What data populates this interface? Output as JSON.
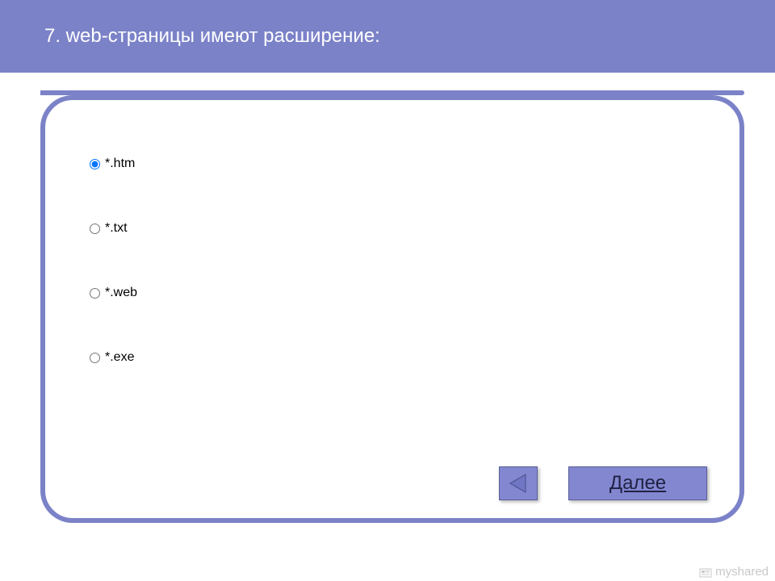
{
  "question": {
    "title": "7. web-страницы имеют расширение:",
    "options": [
      {
        "label": "*.htm",
        "selected": true
      },
      {
        "label": "*.txt",
        "selected": false
      },
      {
        "label": "*.web",
        "selected": false
      },
      {
        "label": "*.exe",
        "selected": false
      }
    ]
  },
  "controls": {
    "next_label": "Далее"
  },
  "watermark": {
    "text": "myshared"
  },
  "colors": {
    "accent": "#7b82c8",
    "button": "#8287d0"
  }
}
